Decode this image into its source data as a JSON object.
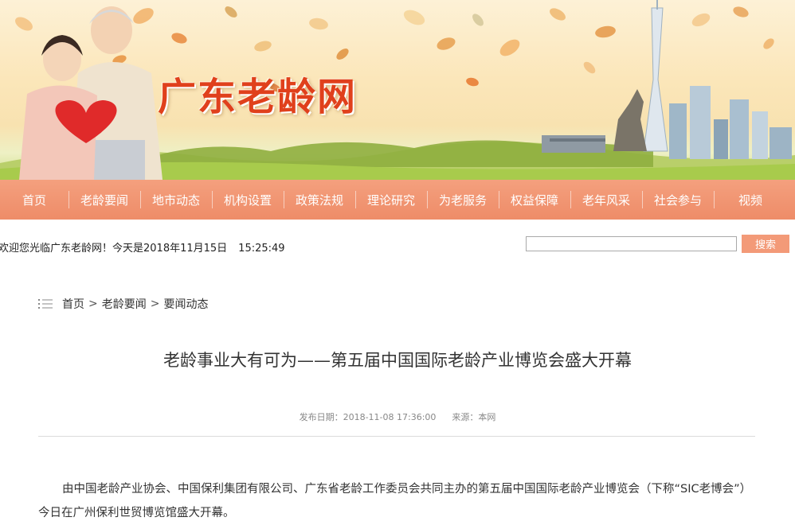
{
  "banner": {
    "site_title": "广东老龄网"
  },
  "nav": {
    "items": [
      {
        "label": "首页"
      },
      {
        "label": "老龄要闻"
      },
      {
        "label": "地市动态"
      },
      {
        "label": "机构设置"
      },
      {
        "label": "政策法规"
      },
      {
        "label": "理论研究"
      },
      {
        "label": "为老服务"
      },
      {
        "label": "权益保障"
      },
      {
        "label": "老年风采"
      },
      {
        "label": "社会参与"
      },
      {
        "label": "视频"
      }
    ]
  },
  "welcome": {
    "text": "欢迎您光临广东老龄网！今天是2018年11月15日",
    "time": "15:25:49"
  },
  "search": {
    "value": "",
    "button_label": "搜索"
  },
  "breadcrumb": {
    "home": "首页",
    "section": "老龄要闻",
    "subsection": "要闻动态",
    "separator": ">"
  },
  "article": {
    "title": "老龄事业大有可为——第五届中国国际老龄产业博览会盛大开幕",
    "publish_date": "发布日期：2018-11-08 17:36:00",
    "source": "来源：本网",
    "paragraph": "由中国老龄产业协会、中国保利集团有限公司、广东省老龄工作委员会共同主办的第五届中国国际老龄产业博览会（下称“SIC老博会”）今日在广州保利世贸博览馆盛大开幕。"
  },
  "colors": {
    "nav_bg": "#ee8c68",
    "title_red": "#e0401c",
    "search_button": "#f39a78"
  }
}
